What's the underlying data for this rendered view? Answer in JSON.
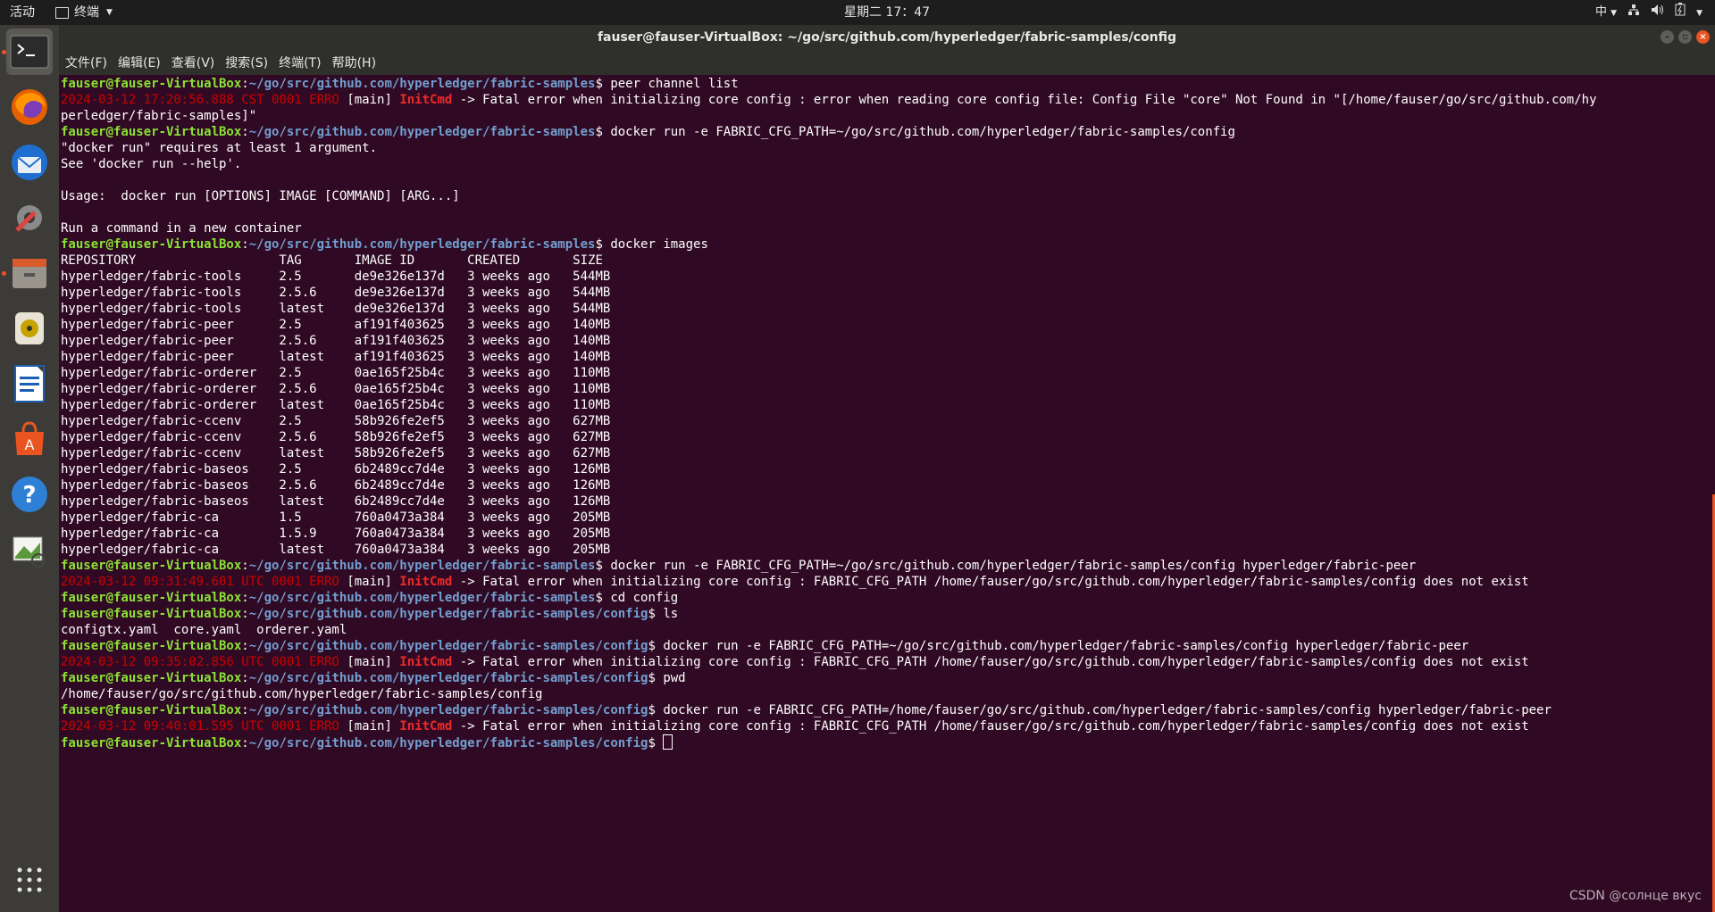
{
  "topbar": {
    "activities": "活动",
    "app_menu": "终端",
    "clock": "星期二 17：47",
    "input_method": "中"
  },
  "dock": {
    "items": [
      {
        "name": "terminal-icon",
        "active": true
      },
      {
        "name": "firefox-icon",
        "active": false
      },
      {
        "name": "thunderbird-icon",
        "active": false
      },
      {
        "name": "settings-icon",
        "active": false
      },
      {
        "name": "files-icon",
        "active": false
      },
      {
        "name": "rhythmbox-icon",
        "active": false
      },
      {
        "name": "libreoffice-writer-icon",
        "active": false
      },
      {
        "name": "software-center-icon",
        "active": false
      },
      {
        "name": "help-icon",
        "active": false
      },
      {
        "name": "image-viewer-icon",
        "active": false
      }
    ]
  },
  "window": {
    "title": "fauser@fauser-VirtualBox: ~/go/src/github.com/hyperledger/fabric-samples/config"
  },
  "menubar": {
    "items": [
      "文件(F)",
      "编辑(E)",
      "查看(V)",
      "搜索(S)",
      "终端(T)",
      "帮助(H)"
    ]
  },
  "terminal": {
    "user": "fauser@fauser-VirtualBox",
    "path_samples": "~/go/src/github.com/hyperledger/fabric-samples",
    "path_config": "~/go/src/github.com/hyperledger/fabric-samples/config",
    "lines": [
      {
        "type": "prompt",
        "path": "samples",
        "cmd": "peer channel list"
      },
      {
        "type": "err",
        "ts": "2024-03-12 17:20:56.888 CST 0001 ERRO",
        "mod": "[main]",
        "tag": "InitCmd",
        "msg": "-> Fatal error when initializing core config : error when reading core config file: Config File \"core\" Not Found in \"[/home/fauser/go/src/github.com/hy"
      },
      {
        "type": "out",
        "text": "perledger/fabric-samples]\""
      },
      {
        "type": "prompt",
        "path": "samples",
        "cmd": "docker run -e FABRIC_CFG_PATH=~/go/src/github.com/hyperledger/fabric-samples/config"
      },
      {
        "type": "out",
        "text": "\"docker run\" requires at least 1 argument."
      },
      {
        "type": "out",
        "text": "See 'docker run --help'."
      },
      {
        "type": "out",
        "text": ""
      },
      {
        "type": "out",
        "text": "Usage:  docker run [OPTIONS] IMAGE [COMMAND] [ARG...]"
      },
      {
        "type": "out",
        "text": ""
      },
      {
        "type": "out",
        "text": "Run a command in a new container"
      },
      {
        "type": "prompt",
        "path": "samples",
        "cmd": "docker images"
      },
      {
        "type": "out",
        "text": "REPOSITORY                   TAG       IMAGE ID       CREATED       SIZE"
      },
      {
        "type": "out",
        "text": "hyperledger/fabric-tools     2.5       de9e326e137d   3 weeks ago   544MB"
      },
      {
        "type": "out",
        "text": "hyperledger/fabric-tools     2.5.6     de9e326e137d   3 weeks ago   544MB"
      },
      {
        "type": "out",
        "text": "hyperledger/fabric-tools     latest    de9e326e137d   3 weeks ago   544MB"
      },
      {
        "type": "out",
        "text": "hyperledger/fabric-peer      2.5       af191f403625   3 weeks ago   140MB"
      },
      {
        "type": "out",
        "text": "hyperledger/fabric-peer      2.5.6     af191f403625   3 weeks ago   140MB"
      },
      {
        "type": "out",
        "text": "hyperledger/fabric-peer      latest    af191f403625   3 weeks ago   140MB"
      },
      {
        "type": "out",
        "text": "hyperledger/fabric-orderer   2.5       0ae165f25b4c   3 weeks ago   110MB"
      },
      {
        "type": "out",
        "text": "hyperledger/fabric-orderer   2.5.6     0ae165f25b4c   3 weeks ago   110MB"
      },
      {
        "type": "out",
        "text": "hyperledger/fabric-orderer   latest    0ae165f25b4c   3 weeks ago   110MB"
      },
      {
        "type": "out",
        "text": "hyperledger/fabric-ccenv     2.5       58b926fe2ef5   3 weeks ago   627MB"
      },
      {
        "type": "out",
        "text": "hyperledger/fabric-ccenv     2.5.6     58b926fe2ef5   3 weeks ago   627MB"
      },
      {
        "type": "out",
        "text": "hyperledger/fabric-ccenv     latest    58b926fe2ef5   3 weeks ago   627MB"
      },
      {
        "type": "out",
        "text": "hyperledger/fabric-baseos    2.5       6b2489cc7d4e   3 weeks ago   126MB"
      },
      {
        "type": "out",
        "text": "hyperledger/fabric-baseos    2.5.6     6b2489cc7d4e   3 weeks ago   126MB"
      },
      {
        "type": "out",
        "text": "hyperledger/fabric-baseos    latest    6b2489cc7d4e   3 weeks ago   126MB"
      },
      {
        "type": "out",
        "text": "hyperledger/fabric-ca        1.5       760a0473a384   3 weeks ago   205MB"
      },
      {
        "type": "out",
        "text": "hyperledger/fabric-ca        1.5.9     760a0473a384   3 weeks ago   205MB"
      },
      {
        "type": "out",
        "text": "hyperledger/fabric-ca        latest    760a0473a384   3 weeks ago   205MB"
      },
      {
        "type": "prompt",
        "path": "samples",
        "cmd": "docker run -e FABRIC_CFG_PATH=~/go/src/github.com/hyperledger/fabric-samples/config hyperledger/fabric-peer"
      },
      {
        "type": "err",
        "ts": "2024-03-12 09:31:49.601 UTC 0001 ERRO",
        "mod": "[main]",
        "tag": "InitCmd",
        "msg": "-> Fatal error when initializing core config : FABRIC_CFG_PATH /home/fauser/go/src/github.com/hyperledger/fabric-samples/config does not exist"
      },
      {
        "type": "prompt",
        "path": "samples",
        "cmd": "cd config"
      },
      {
        "type": "prompt",
        "path": "config",
        "cmd": "ls"
      },
      {
        "type": "out",
        "text": "configtx.yaml  core.yaml  orderer.yaml"
      },
      {
        "type": "prompt",
        "path": "config",
        "cmd": "docker run -e FABRIC_CFG_PATH=~/go/src/github.com/hyperledger/fabric-samples/config hyperledger/fabric-peer"
      },
      {
        "type": "err",
        "ts": "2024-03-12 09:35:02.856 UTC 0001 ERRO",
        "mod": "[main]",
        "tag": "InitCmd",
        "msg": "-> Fatal error when initializing core config : FABRIC_CFG_PATH /home/fauser/go/src/github.com/hyperledger/fabric-samples/config does not exist"
      },
      {
        "type": "prompt",
        "path": "config",
        "cmd": "pwd"
      },
      {
        "type": "out",
        "text": "/home/fauser/go/src/github.com/hyperledger/fabric-samples/config"
      },
      {
        "type": "prompt",
        "path": "config",
        "cmd": "docker run -e FABRIC_CFG_PATH=/home/fauser/go/src/github.com/hyperledger/fabric-samples/config hyperledger/fabric-peer"
      },
      {
        "type": "err",
        "ts": "2024-03-12 09:40:01.595 UTC 0001 ERRO",
        "mod": "[main]",
        "tag": "InitCmd",
        "msg": "-> Fatal error when initializing core config : FABRIC_CFG_PATH /home/fauser/go/src/github.com/hyperledger/fabric-samples/config does not exist"
      },
      {
        "type": "prompt",
        "path": "config",
        "cmd": "",
        "cursor": true
      }
    ]
  },
  "watermark": "CSDN @солнце вкус"
}
